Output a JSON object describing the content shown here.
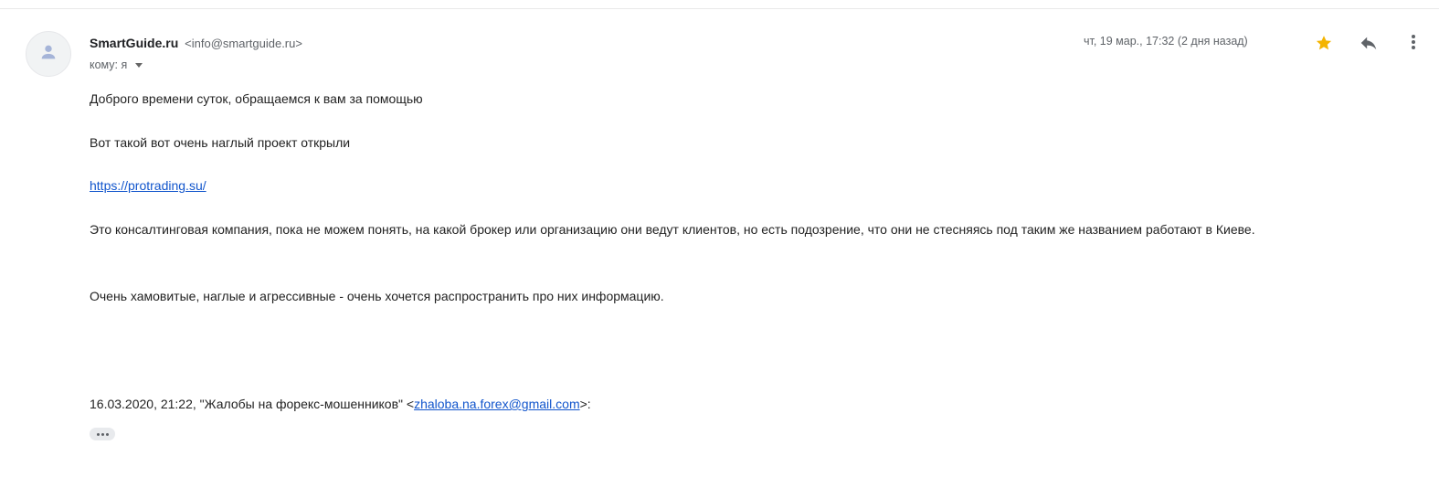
{
  "header": {
    "sender_name": "SmartGuide.ru",
    "sender_email": "<info@smartguide.ru>",
    "to_label": "кому: я",
    "date": "чт, 19 мар., 17:32 (2 дня назад)",
    "star_color": "#f4b400"
  },
  "icons": {
    "avatar": "person-icon",
    "star": "star-icon",
    "reply": "reply-icon",
    "more": "more-vert-icon",
    "to_toggle": "chevron-down-icon"
  },
  "body": {
    "p1": "Доброго времени суток, обращаемся к вам за помощью",
    "p2": "Вот такой вот очень наглый проект открыли",
    "link": "https://protrading.su/",
    "p4": "Это консалтинговая компания, пока не можем понять, на какой брокер или организацию они ведут клиентов, но есть подозрение, что они не стесняясь под таким же названием работают в Киеве.",
    "p5": "Очень хамовитые, наглые и агрессивные - очень хочется распространить про них информацию.",
    "quote_prefix": "16.03.2020, 21:22, \"Жалобы на форекс-мошенников\" <",
    "quote_email": "zhaloba.na.forex@gmail.com",
    "quote_suffix": ">:"
  }
}
